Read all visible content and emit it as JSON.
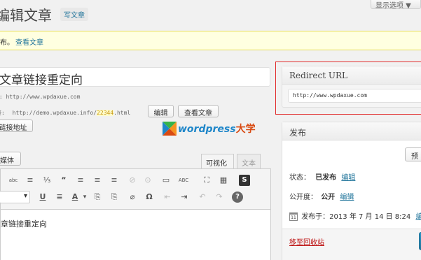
{
  "header": {
    "title": "编辑文章",
    "add_new": "写文章",
    "screen_options": "显示选项 ▼"
  },
  "notice": {
    "text_prefix": "布。",
    "view_post": "查看文章"
  },
  "post": {
    "title": "文章链接重定向",
    "shortlink": "t: http://www.wpdaxue.com",
    "permalink_label": "接:",
    "permalink_url": "http://demo.wpdaxue.info/",
    "permalink_id": "22344",
    "permalink_suffix": ".html",
    "edit_button": "编辑",
    "view_button": "查看文章",
    "get_shortlink": "链接地址"
  },
  "logo": {
    "text_main": "wordpress",
    "text_suffix": "大学"
  },
  "editor": {
    "add_media": "媒体",
    "tab_visual": "可视化",
    "tab_text": "文本",
    "content": "章链接重定向",
    "toolbar_row1": [
      "abc",
      "≡",
      "⅓",
      "“",
      "≡",
      "≡",
      "≡",
      "⊘",
      "⊙",
      "▭",
      "ABC",
      "⛶",
      "▦",
      "S"
    ],
    "toolbar_row2": [
      "▾",
      "U",
      "≣",
      "A",
      "▾",
      "⎘",
      "⎘",
      "⌀",
      "Ω",
      "⇤",
      "⇥",
      "↶",
      "↷",
      "?"
    ]
  },
  "redirect_box": {
    "title": "Redirect URL",
    "value": "http://www.wpdaxue.com"
  },
  "publish_box": {
    "title": "发布",
    "preview_button": "预",
    "status_label": "状态：",
    "status_value": "已发布",
    "status_edit": "编辑",
    "visibility_label": "公开度：",
    "visibility_value": "公开",
    "visibility_edit": "编辑",
    "date_icon_label": "11",
    "published_on": "发布于：2013 年 7 月 14 日 8:24",
    "date_edit": "编",
    "trash_link": "移至回收站"
  },
  "colors": {
    "link": "#21759b",
    "trash": "#bc0b0b",
    "notice_bg": "#ffffe0",
    "highlight_red": "#e12b2b",
    "logo_blue": "#1e86c9",
    "logo_orange": "#d94a12"
  }
}
